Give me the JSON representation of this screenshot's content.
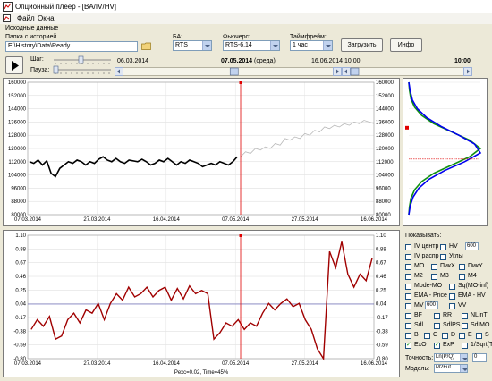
{
  "window": {
    "title": "Опционный плеер - [BA/IV/HV]"
  },
  "menu": [
    "Файл",
    "Окна"
  ],
  "source": {
    "header": "Исходные данные",
    "folder_label": "Папка с историей",
    "folder_value": "E:\\History\\Data\\Ready",
    "ba_label": "БА:",
    "ba_value": "RTS",
    "futures_label": "Фьючерс:",
    "futures_value": "RTS-6.14",
    "timeframe_label": "Таймфрейм:",
    "timeframe_value": "1 час",
    "load_button": "Загрузить",
    "info_button": "Инфо"
  },
  "player": {
    "step_label": "Шаг:",
    "pause_label": "Пауза:",
    "start_date": "06.03.2014",
    "current_date": "07.05.2014",
    "weekday": "(среда)",
    "end_date": "16.06.2014",
    "time_start": "10:00",
    "time_current": "10:00",
    "slider_fraction": 0.53
  },
  "colors": {
    "price_line": "#000000",
    "future_line": "#b8b8b8",
    "cursor": "#e00000",
    "iv_line": "#a00000",
    "zero_line": "#3030a0",
    "curve_blue": "#0000ee",
    "curve_green": "#109010"
  },
  "chart_data": [
    {
      "type": "line",
      "title": "",
      "ylim": [
        80000,
        160000
      ],
      "yticks": [
        "160000",
        "152000",
        "144000",
        "136000",
        "128000",
        "120000",
        "112000",
        "104000",
        "96000",
        "88000",
        "80000"
      ],
      "xtick_labels": [
        "07.03.2014",
        "27.03.2014",
        "16.04.2014",
        "07.05.2014",
        "27.05.2014",
        "16.06.2014"
      ],
      "series": [
        {
          "values": [
            112000,
            111000,
            113000,
            110000,
            112500,
            105000,
            103000,
            108000,
            110000,
            112000,
            111000,
            113000,
            112000,
            110000,
            112000,
            111000,
            113500,
            115000,
            113000,
            112000,
            114000,
            112000,
            111000,
            113000,
            112500,
            112000,
            113500,
            112000,
            110000,
            111000,
            113000,
            112000,
            114000,
            112000,
            110000,
            112000,
            111000,
            113000,
            112000,
            111000,
            109000,
            110000,
            111000,
            110000,
            112000,
            111000,
            110000,
            112000,
            115000
          ]
        },
        {
          "values": [
            115000,
            118000,
            117000,
            120000,
            119000,
            121000,
            120000,
            123000,
            122000,
            126000,
            125000,
            127000,
            126000,
            129000,
            128000,
            131000,
            130000,
            133000,
            132000,
            134000,
            133000,
            135000,
            134000,
            136000,
            135000,
            137000,
            136000,
            135000
          ]
        }
      ],
      "cursor_label": "07.05.2014"
    },
    {
      "type": "line",
      "title": "",
      "ylim": [
        -0.8,
        1.1
      ],
      "yticks": [
        "1.10",
        "0.88",
        "0.67",
        "0.46",
        "0.25",
        "0.04",
        "-0.17",
        "-0.38",
        "-0.59",
        "-0.80"
      ],
      "right_yticks": [
        "1.10",
        "0.88",
        "0.67",
        "0.46",
        "0.25",
        "0.04",
        "-0.17",
        "-0.38",
        "-0.59",
        "-0.80"
      ],
      "xtick_labels": [
        "07.03.2014",
        "27.03.2014",
        "16.04.2014",
        "07.05.2014",
        "27.05.2014",
        "16.06.2014"
      ],
      "series": [
        {
          "values": [
            -0.35,
            -0.2,
            -0.3,
            -0.15,
            -0.5,
            -0.45,
            -0.2,
            -0.1,
            -0.25,
            -0.05,
            -0.1,
            0.05,
            -0.2,
            0.05,
            0.2,
            0.1,
            0.3,
            0.15,
            0.2,
            0.3,
            0.15,
            0.25,
            0.3,
            0.1,
            0.28,
            0.12,
            0.32,
            0.2,
            0.25,
            0.2,
            -0.5,
            -0.4,
            -0.25,
            -0.3,
            -0.2,
            -0.35,
            -0.25,
            -0.3,
            -0.1,
            0.05,
            -0.05,
            0.05,
            0.12,
            0.0,
            0.05,
            -0.2,
            -0.35,
            -0.65,
            -0.8,
            0.85,
            0.6,
            1.0,
            0.5,
            0.3,
            0.5,
            0.4,
            0.75
          ]
        }
      ],
      "footer": "Pexc=0.02, Time=45%"
    },
    {
      "type": "line",
      "title": "",
      "series": [
        {
          "values": [
            0.0,
            0.01,
            0.03,
            0.08,
            0.18,
            0.35,
            0.6,
            0.85,
            1.0,
            0.85,
            0.6,
            0.35,
            0.18,
            0.08,
            0.03,
            0.01,
            0.0
          ]
        },
        {
          "values": [
            0.0,
            0.02,
            0.05,
            0.12,
            0.25,
            0.45,
            0.7,
            0.92,
            1.0,
            0.78,
            0.5,
            0.28,
            0.14,
            0.06,
            0.02,
            0.0
          ]
        }
      ]
    }
  ],
  "options": {
    "header": "Показывать:",
    "items": [
      {
        "label": "IV центр",
        "checked": false
      },
      {
        "label": "HV",
        "checked": false,
        "value": "600"
      },
      {
        "label": "IV распр",
        "checked": false
      },
      {
        "label": "Углы",
        "checked": false
      },
      {
        "label": "MO",
        "checked": false
      },
      {
        "label": "ПикX",
        "checked": false
      },
      {
        "label": "ПикY",
        "checked": false
      },
      {
        "label": "M2",
        "checked": false
      },
      {
        "label": "M3",
        "checked": false
      },
      {
        "label": "M4",
        "checked": false
      },
      {
        "label": "Mode-MO",
        "checked": false
      },
      {
        "label": "Sq(MO-inf)",
        "checked": false
      },
      {
        "label": "EMA - Price",
        "checked": false
      },
      {
        "label": "EMA - HV",
        "checked": false
      },
      {
        "label": "MV",
        "checked": false,
        "value": "600"
      },
      {
        "label": "VV",
        "checked": false
      },
      {
        "label": "BF",
        "checked": false
      },
      {
        "label": "RR",
        "checked": false
      },
      {
        "label": "NLinT",
        "checked": false
      },
      {
        "label": "Sdl",
        "checked": false
      },
      {
        "label": "SdlPS",
        "checked": false
      },
      {
        "label": "SdlMO",
        "checked": false
      },
      {
        "label": "B",
        "checked": false
      },
      {
        "label": "C",
        "checked": false
      },
      {
        "label": "D",
        "checked": false
      },
      {
        "label": "E",
        "checked": false
      },
      {
        "label": "S",
        "checked": false
      },
      {
        "label": "ExO",
        "checked": true
      },
      {
        "label": "ExP",
        "checked": true
      },
      {
        "label": "1/Sqrt(T)",
        "checked": false
      }
    ],
    "accuracy_label": "Точность:",
    "accuracy_value": "Ln(P/Q)",
    "accuracy_num": "0",
    "model_label": "Модель:",
    "model_value": "M2Fut"
  }
}
